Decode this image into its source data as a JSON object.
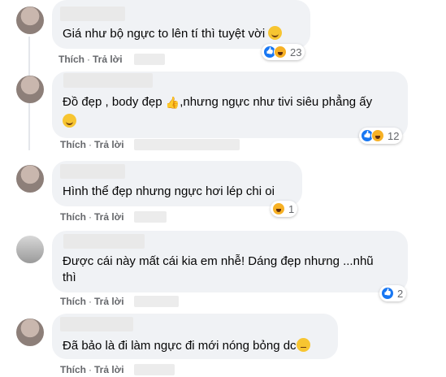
{
  "actions": {
    "like": "Thích",
    "reply": "Trả lời",
    "separator": "·"
  },
  "comments": [
    {
      "text": "Giá như bộ ngực to lên tí thì tuyệt vời",
      "trailing_emoji": "smile",
      "reactions": {
        "icons": [
          "like",
          "haha"
        ],
        "count": "23"
      }
    },
    {
      "text_line1": "Đồ đẹp , body đẹp",
      "text_line1b": ",nhưng ngực như tivi siêu phẳng ấy",
      "inline_emoji": "thumbs-up",
      "trailing_emoji": "smile",
      "reactions": {
        "icons": [
          "like",
          "haha"
        ],
        "count": "12"
      }
    },
    {
      "text": "Hình thể đẹp nhưng ngực hơi lép chi oi",
      "reactions": {
        "icons": [
          "haha"
        ],
        "count": "1"
      }
    },
    {
      "text_line1": "Được cái này mất cái kia em nhễ! Dáng đẹp nhưng ...nhũ",
      "text_line2": "thì",
      "reactions": {
        "icons": [
          "like"
        ],
        "count": "2"
      }
    },
    {
      "text": "Đã bảo là đi làm ngực đi mới nóng bỏng dc",
      "trailing_emoji": "rolling-eyes"
    }
  ]
}
